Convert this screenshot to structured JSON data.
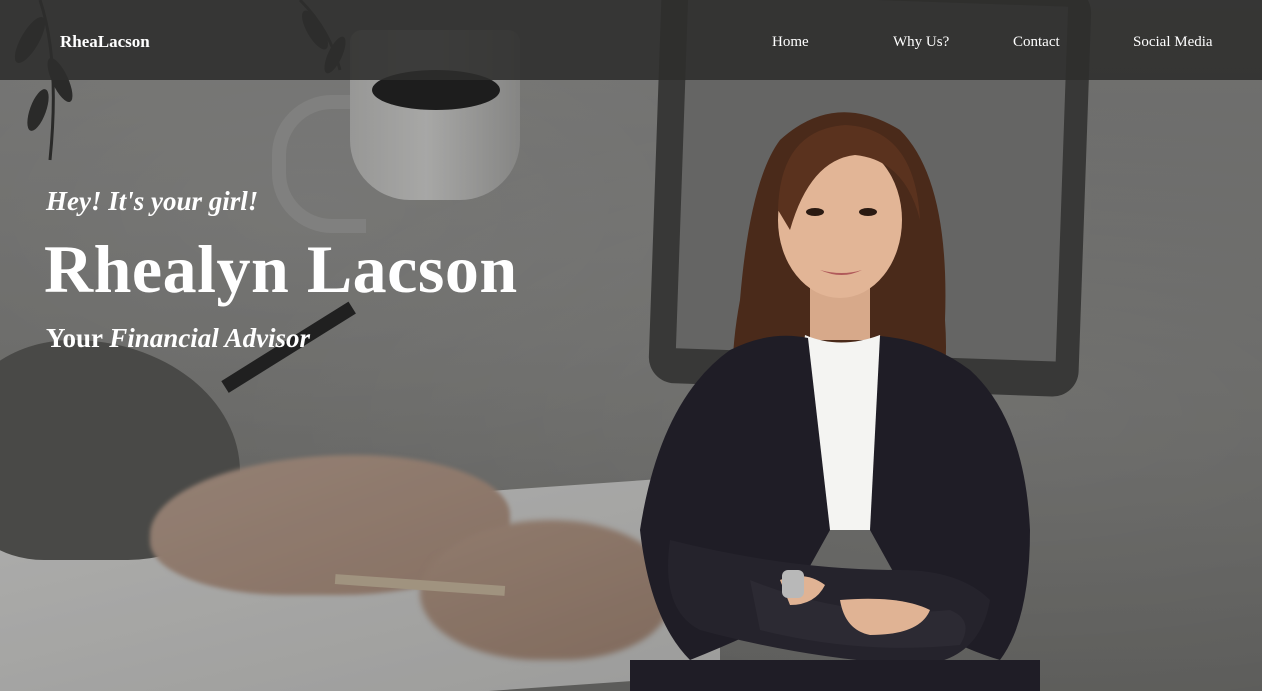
{
  "nav": {
    "brand": "RheaLacson",
    "links": [
      {
        "label": "Home"
      },
      {
        "label": "Why Us?"
      },
      {
        "label": "Contact"
      },
      {
        "label": "Social Media"
      }
    ]
  },
  "hero": {
    "greeting": "Hey! It's your girl!",
    "name": "Rhealyn Lacson",
    "role_prefix": "Your",
    "role_title": "Financial Advisor"
  },
  "colors": {
    "navbar_bg": "#2d2d2c",
    "text": "#ffffff",
    "blazer": "#1f1d26",
    "shirt": "#f4f4f2"
  }
}
